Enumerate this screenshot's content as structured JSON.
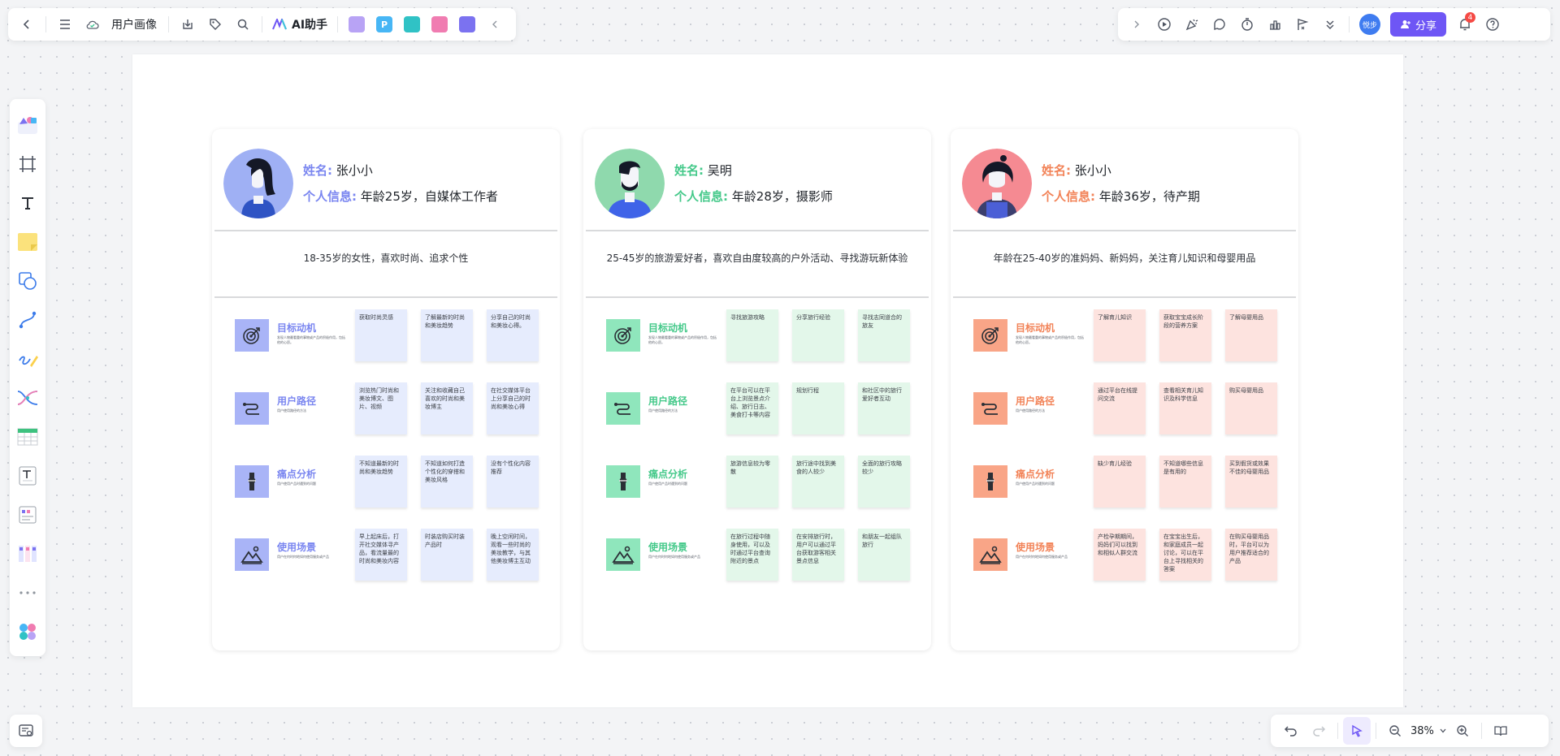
{
  "toolbar_left": {
    "file_title": "用户画像",
    "ai_label": "AI助手",
    "plugins": [
      {
        "name": "image-plugin-icon",
        "text": "",
        "color": "#b8a3f5"
      },
      {
        "name": "p-plugin-icon",
        "text": "P",
        "color": "#47b6f5"
      },
      {
        "name": "flow-plugin-icon",
        "text": "",
        "color": "#30c2c5"
      },
      {
        "name": "mindmap-plugin-icon",
        "text": "",
        "color": "#f07cb1"
      },
      {
        "name": "chat-plugin-icon",
        "text": "",
        "color": "#7b72f0"
      }
    ]
  },
  "toolbar_right": {
    "avatar_text": "悦步",
    "share_label": "分享",
    "notification_count": "4"
  },
  "zoom": {
    "level": "38%"
  },
  "personas": [
    {
      "accent": "#7a86f0",
      "icon_bg": "#a9b4f7",
      "sticky_bg": "#e6ecfd",
      "avatar_bg": "#9fb0f4",
      "name_label": "姓名:",
      "name": "张小小",
      "info_label": "个人信息:",
      "info": "年龄25岁，自媒体工作者",
      "summary": "18-35岁的女性，喜欢时尚、追求个性",
      "rows": [
        {
          "title": "目标动机",
          "desc": "发现人物最看重的事物或产品的积极作用，包括他的心愿。",
          "notes": [
            "获取时尚灵感",
            "了解最新的时尚和美妆趋势",
            "分享自己的时尚和美妆心得。"
          ]
        },
        {
          "title": "用户路径",
          "desc": "用户使用路径的方法",
          "notes": [
            "浏览热门时尚和美妆博文、图片、视频",
            "关注和收藏自己喜欢的时尚和美妆博主",
            "在社交媒体平台上分享自己的时尚和美妆心得"
          ]
        },
        {
          "title": "痛点分析",
          "desc": "用户使用产品时遇到的问题",
          "notes": [
            "不知道最新的时尚和美妆趋势",
            "不知道如何打造个性化的穿搭和美妆风格",
            "没有个性化内容推荐"
          ]
        },
        {
          "title": "使用场景",
          "desc": "用户在何时何地如何使用服务或产品",
          "notes": [
            "早上起床后，打开社交媒体寻产品，看流量最的时尚和美妆内容",
            "时装店购买时装产品时",
            "晚上空闲时间，观看一些时尚的美妆教学，与其他美妆博主互动"
          ]
        }
      ]
    },
    {
      "accent": "#45c98a",
      "icon_bg": "#8fe6bc",
      "sticky_bg": "#e3f7ea",
      "avatar_bg": "#8fd9ad",
      "name_label": "姓名:",
      "name": "吴明",
      "info_label": "个人信息:",
      "info": "年龄28岁，摄影师",
      "summary": "25-45岁的旅游爱好者，喜欢自由度较高的户外活动、寻找游玩新体验",
      "rows": [
        {
          "title": "目标动机",
          "desc": "发现人物最看重的事物或产品的积极作用，包括他的心愿。",
          "notes": [
            "寻找旅游攻略",
            "分享旅行经验",
            "寻找志同道合的旅友"
          ]
        },
        {
          "title": "用户路径",
          "desc": "用户使用路径的方法",
          "notes": [
            "在平台可以在平台上浏览景点介绍、旅行日志、美食打卡等内容",
            "规划行程",
            "和社区中的旅行爱好者互动"
          ]
        },
        {
          "title": "痛点分析",
          "desc": "用户使用产品时遇到的问题",
          "notes": [
            "旅游信息较为零散",
            "旅行途中找到美食的人较少",
            "全面的旅行攻略较少"
          ]
        },
        {
          "title": "使用场景",
          "desc": "用户在何时何地如何使用服务或产品",
          "notes": [
            "在旅行过程中随身使用，可以及时通过平台查询附近的景点",
            "在安排旅行时，用户可以通过平台获取游客相关景点信息",
            "和朋友一起组队旅行"
          ]
        }
      ]
    },
    {
      "accent": "#f28358",
      "icon_bg": "#f9a587",
      "sticky_bg": "#fde3df",
      "avatar_bg": "#f58a92",
      "name_label": "姓名:",
      "name": "张小小",
      "info_label": "个人信息:",
      "info": "年龄36岁，待产期",
      "summary": "年龄在25-40岁的准妈妈、新妈妈，关注育儿知识和母婴用品",
      "rows": [
        {
          "title": "目标动机",
          "desc": "发现人物最看重的事物或产品的积极作用，包括他的心愿。",
          "notes": [
            "了解育儿知识",
            "获取宝宝成长阶段的营养方案",
            "了解母婴用品"
          ]
        },
        {
          "title": "用户路径",
          "desc": "用户使用路径的方法",
          "notes": [
            "通过平台在线提问交流",
            "查看相关育儿知识及科学信息",
            "购买母婴用品"
          ]
        },
        {
          "title": "痛点分析",
          "desc": "用户使用产品时遇到的问题",
          "notes": [
            "缺少育儿经验",
            "不知道哪些信息是有用的",
            "买到假货或效果不佳的母婴用品"
          ]
        },
        {
          "title": "使用场景",
          "desc": "用户在何时何地如何使用服务或产品",
          "notes": [
            "产检孕期期间，妈妈们可以找到和相似人群交流",
            "在宝宝出生后，和家庭成员一起讨论，可以在平台上寻找相关的答案",
            "在购买母婴用品时，平台可以为用户推荐适合的产品"
          ]
        }
      ]
    }
  ]
}
